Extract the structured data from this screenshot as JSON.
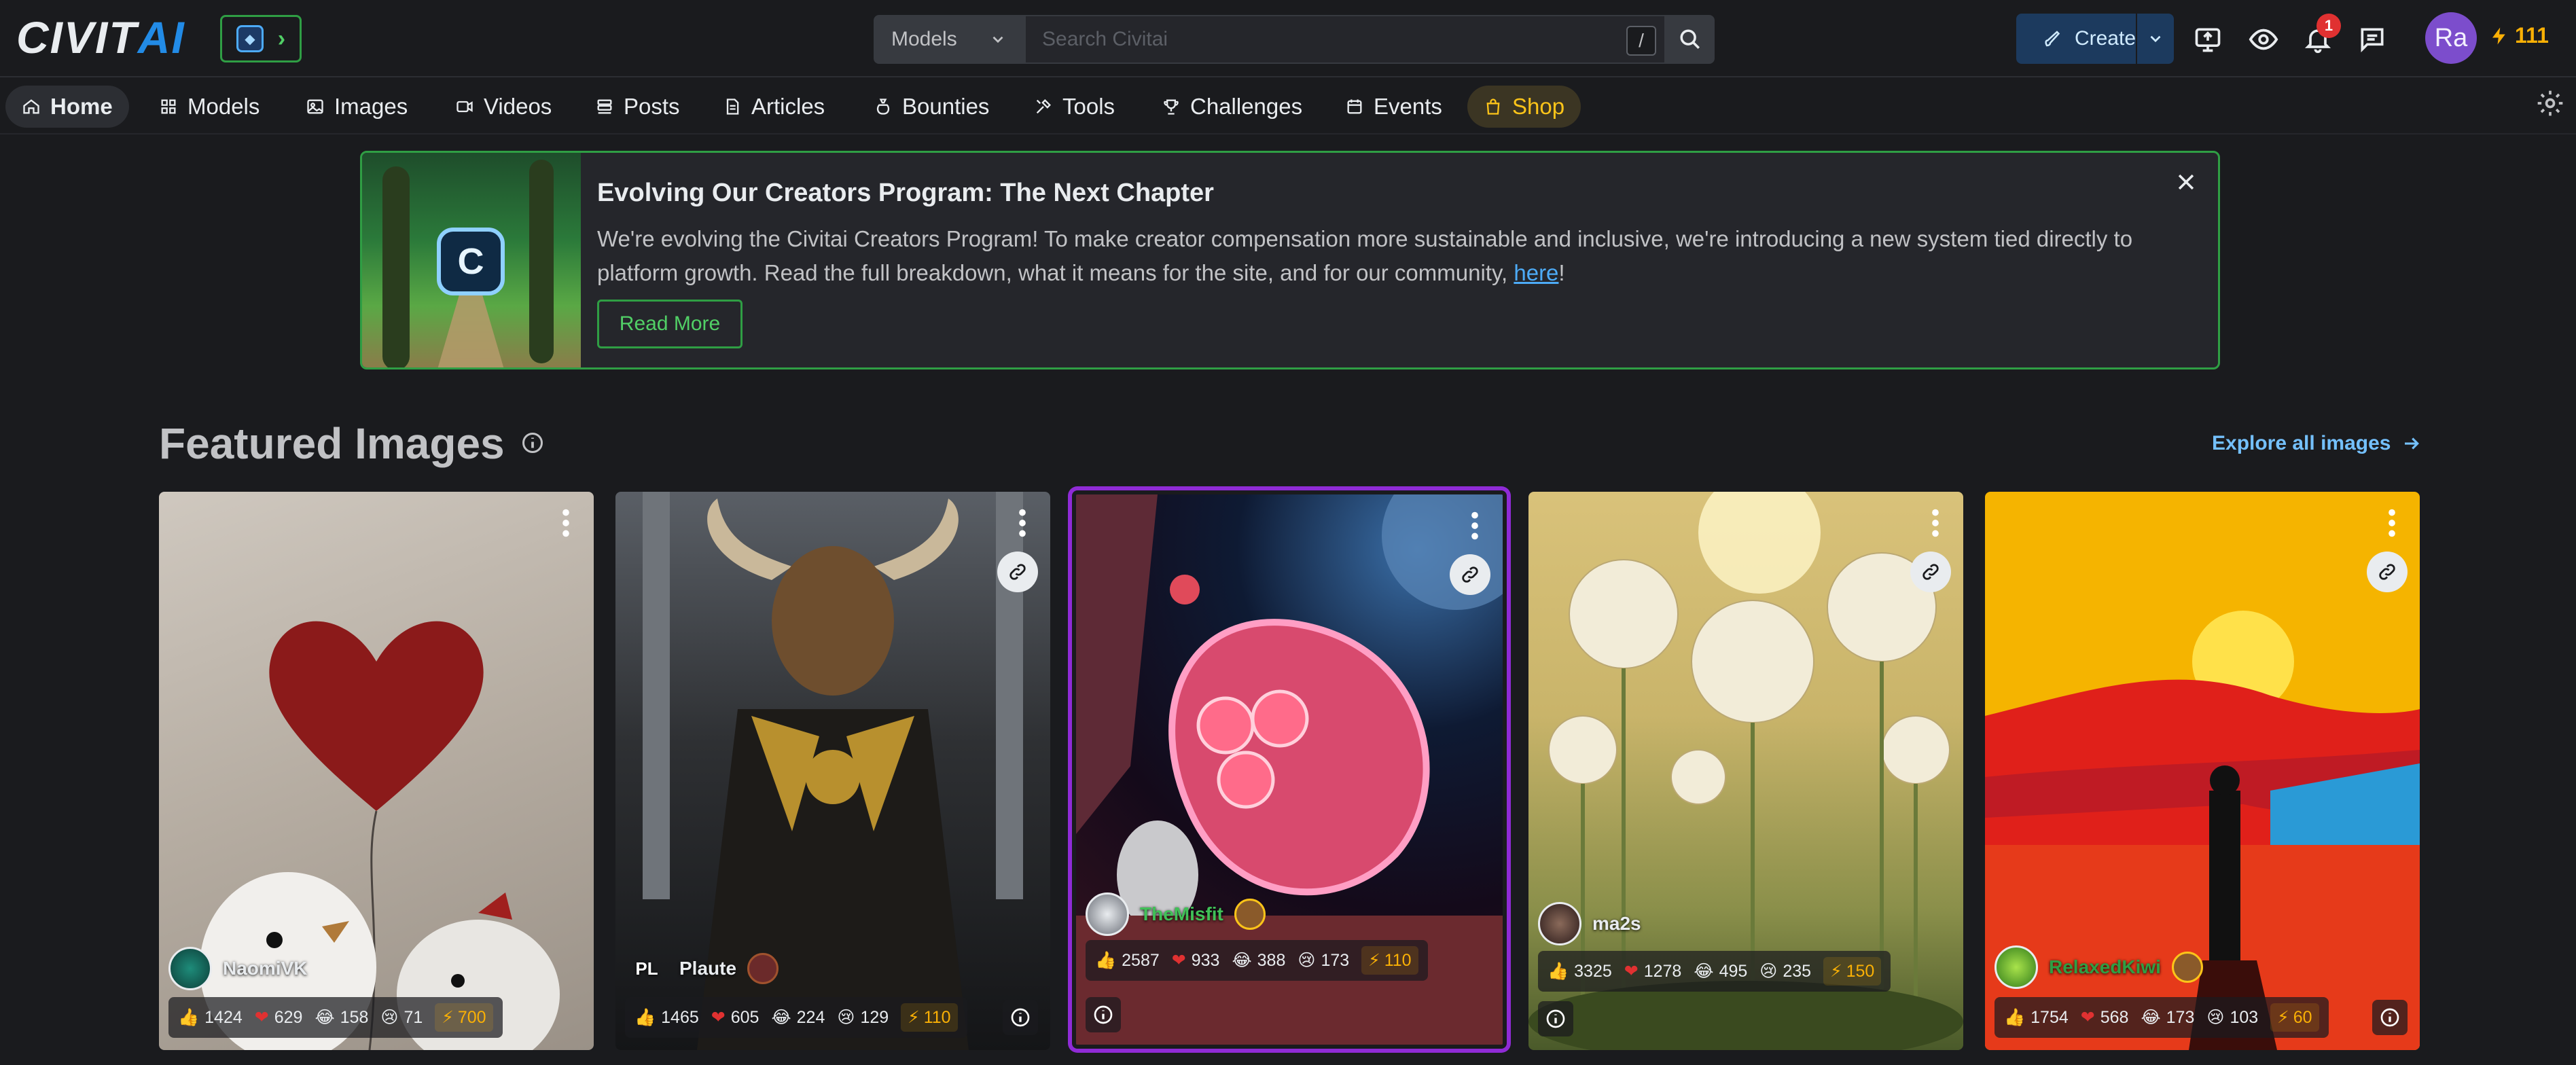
{
  "header": {
    "logo": {
      "part1": "CIVIT",
      "part2": "AI"
    },
    "search": {
      "scope": "Models",
      "placeholder": "Search Civitai",
      "shortcut": "/"
    },
    "create_label": "Create",
    "notifications_count": "1",
    "avatar_initials": "Ra",
    "buzz_balance": "111"
  },
  "nav": {
    "items": [
      {
        "label": "Home"
      },
      {
        "label": "Models"
      },
      {
        "label": "Images"
      },
      {
        "label": "Videos"
      },
      {
        "label": "Posts"
      },
      {
        "label": "Articles"
      },
      {
        "label": "Bounties"
      },
      {
        "label": "Tools"
      },
      {
        "label": "Challenges"
      },
      {
        "label": "Events"
      },
      {
        "label": "Shop"
      }
    ]
  },
  "banner": {
    "title": "Evolving Our Creators Program: The Next Chapter",
    "text_before_link": "We're evolving the Civitai Creators Program! To make creator compensation more sustainable and inclusive, we're introducing a new system tied directly to platform growth. Read the full breakdown, what it means for the site, and for our community, ",
    "link": "here",
    "text_after_link": "!",
    "button": "Read More"
  },
  "featured": {
    "title": "Featured Images",
    "explore": "Explore all images",
    "cards": [
      {
        "user": "NaomiVK",
        "likes": "1424",
        "hearts": "629",
        "laughs": "158",
        "cries": "71",
        "buzz": "700"
      },
      {
        "user_prefix": "PL",
        "user": "Plaute",
        "likes": "1465",
        "hearts": "605",
        "laughs": "224",
        "cries": "129",
        "buzz": "110"
      },
      {
        "user": "TheMisfit",
        "likes": "2587",
        "hearts": "933",
        "laughs": "388",
        "cries": "173",
        "buzz": "110"
      },
      {
        "user": "ma2s",
        "likes": "3325",
        "hearts": "1278",
        "laughs": "495",
        "cries": "235",
        "buzz": "150"
      },
      {
        "user": "RelaxedKiwi",
        "likes": "1754",
        "hearts": "568",
        "laughs": "173",
        "cries": "103",
        "buzz": "60"
      }
    ]
  },
  "colors": {
    "accent": "#228be6",
    "success": "#2f9e44",
    "buzz": "#fab005",
    "bg": "#1a1b1e"
  }
}
